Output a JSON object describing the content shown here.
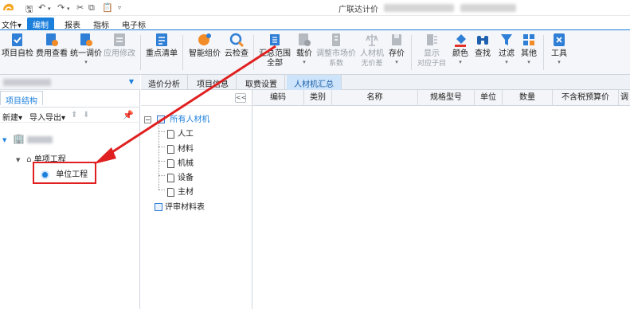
{
  "window": {
    "title": "广联达计价"
  },
  "menu": {
    "items": [
      "文件▾",
      "编制",
      "报表",
      "指标",
      "电子标"
    ],
    "active": "编制"
  },
  "toolbar": {
    "project_check": "项目自检",
    "fee_view": "费用查看",
    "unified_price": "统一调价",
    "apply_modify": "应用修改",
    "key_list": "重点清单",
    "smart_price": "智能组价",
    "cloud_check": "云检查",
    "summary_scope_l1": "汇总范围",
    "summary_scope_l2": "全部",
    "load_price": "载价",
    "adjust_market_l1": "调整市场价",
    "adjust_market_l2": "系数",
    "labor_machine_l1": "人材机",
    "labor_machine_l2": "无价差",
    "save_price": "存价",
    "show_sub_l1": "显示",
    "show_sub_l2": "对应子目",
    "color": "颜色",
    "find": "查找",
    "filter": "过滤",
    "other": "其他",
    "tools": "工具"
  },
  "left_panel": {
    "tab": "项目结构",
    "new": "新建▾",
    "import_export": "导入导出▾",
    "up": "⬆",
    "down": "⬇",
    "tree": {
      "single_project": "单项工程",
      "unit_project": "单位工程"
    }
  },
  "main_tabs": [
    "造价分析",
    "项目信息",
    "取费设置",
    "人材机汇总"
  ],
  "main_tab_active": "人材机汇总",
  "mid_tree": {
    "collapse": "<<",
    "root": "所有人材机",
    "children": [
      "人工",
      "材料",
      "机械",
      "设备",
      "主材"
    ],
    "review": "评审材料表"
  },
  "grid": {
    "columns": [
      "编码",
      "类别",
      "名称",
      "规格型号",
      "单位",
      "数量",
      "不含税预算价",
      "调"
    ]
  }
}
